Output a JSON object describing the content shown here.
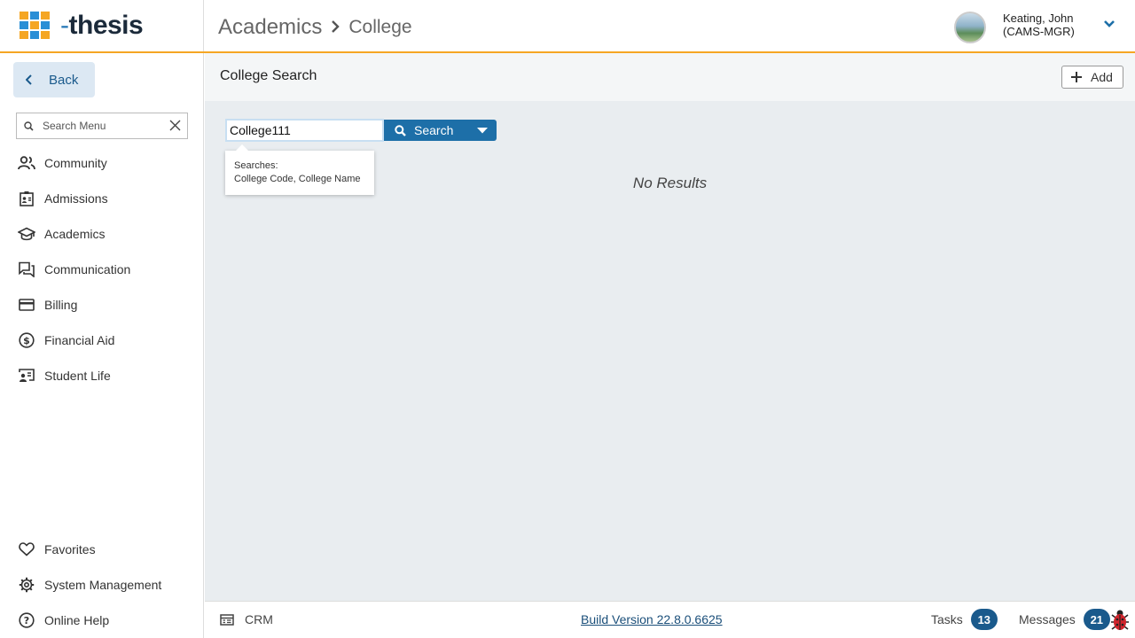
{
  "app": {
    "name": "thesis",
    "logo_prefix": "-",
    "logo_colors": [
      "#f5a623",
      "#2a8fd6"
    ]
  },
  "breadcrumb": {
    "root": "Academics",
    "current": "College"
  },
  "user": {
    "name_line1": "Keating, John",
    "name_line2": "(CAMS-MGR)"
  },
  "sidebar": {
    "back_label": "Back",
    "search_placeholder": "Search Menu",
    "items": [
      {
        "label": "Community",
        "icon": "people-icon"
      },
      {
        "label": "Admissions",
        "icon": "id-card-icon"
      },
      {
        "label": "Academics",
        "icon": "graduation-cap-icon"
      },
      {
        "label": "Communication",
        "icon": "chat-icon"
      },
      {
        "label": "Billing",
        "icon": "credit-card-icon"
      },
      {
        "label": "Financial Aid",
        "icon": "dollar-icon"
      },
      {
        "label": "Student Life",
        "icon": "student-life-icon"
      }
    ],
    "bottom_items": [
      {
        "label": "Favorites",
        "icon": "heart-icon"
      },
      {
        "label": "System Management",
        "icon": "gear-icon"
      },
      {
        "label": "Online Help",
        "icon": "help-icon"
      }
    ]
  },
  "main": {
    "title": "College Search",
    "add_label": "Add",
    "search_value": "College111",
    "search_button": "Search",
    "tooltip_line1": "Searches:",
    "tooltip_line2": "College Code, College Name",
    "no_results": "No Results"
  },
  "footer": {
    "crm_label": "CRM",
    "build_version": "Build Version 22.8.0.6625",
    "tasks_label": "Tasks",
    "tasks_count": "13",
    "messages_label": "Messages",
    "messages_count": "21"
  },
  "colors": {
    "accent_orange": "#f5a623",
    "primary_blue": "#1d6fa8",
    "badge_blue": "#1a5a8c"
  }
}
